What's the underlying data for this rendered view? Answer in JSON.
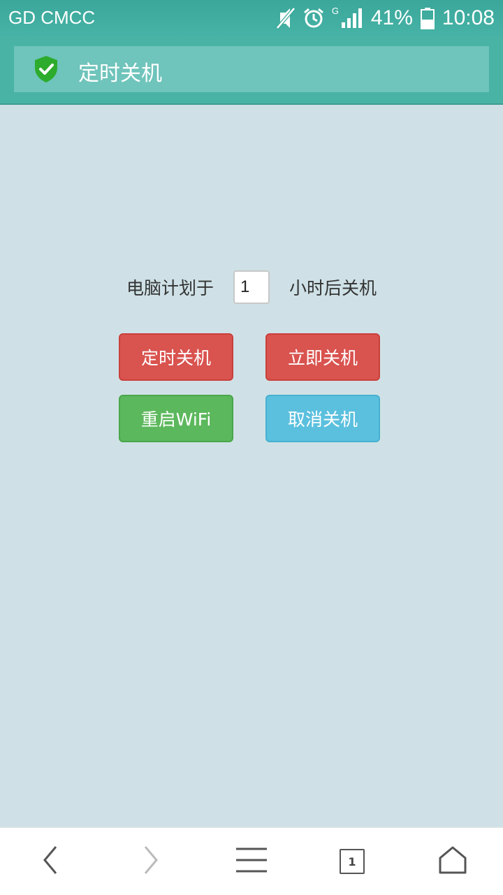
{
  "status_bar": {
    "carrier": "GD CMCC",
    "network_type": "G",
    "battery_percent": "41%",
    "time": "10:08",
    "icons": [
      "mute-icon",
      "alarm-icon",
      "signal-icon",
      "battery-icon"
    ]
  },
  "header": {
    "title": "定时关机",
    "icon": "shield-check-icon"
  },
  "form": {
    "label_before": "电脑计划于",
    "hours_value": "1",
    "label_after": "小时后关机"
  },
  "buttons": {
    "scheduled_shutdown": "定时关机",
    "shutdown_now": "立即关机",
    "restart_wifi": "重启WiFi",
    "cancel_shutdown": "取消关机"
  },
  "navbar": {
    "tab_count": "1",
    "icons": [
      "back-icon",
      "forward-icon",
      "menu-icon",
      "tabs-icon",
      "home-icon"
    ]
  },
  "colors": {
    "header": "#49b3a6",
    "background": "#cfe1e6",
    "danger": "#d9534f",
    "success": "#5cb85c",
    "info": "#5bc0de"
  }
}
